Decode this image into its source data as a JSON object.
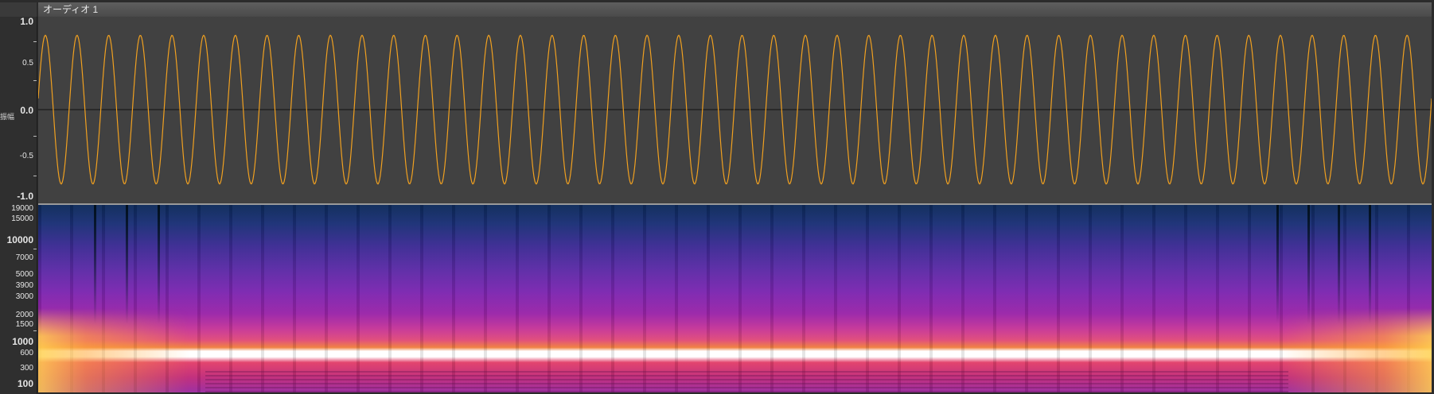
{
  "track": {
    "name": "オーディオ 1"
  },
  "waveform": {
    "axis_label": "振幅",
    "ticks": [
      "1.0",
      "0.5",
      "0.0",
      "-0.5",
      "-1.0"
    ],
    "color": "#f0a020",
    "amplitude": 0.8,
    "cycles": 44
  },
  "spectrogram": {
    "ticks": [
      "19000",
      "15000",
      "10000",
      "7000",
      "5000",
      "3900",
      "3000",
      "2000",
      "1500",
      "1000",
      "600",
      "300",
      "100"
    ]
  }
}
